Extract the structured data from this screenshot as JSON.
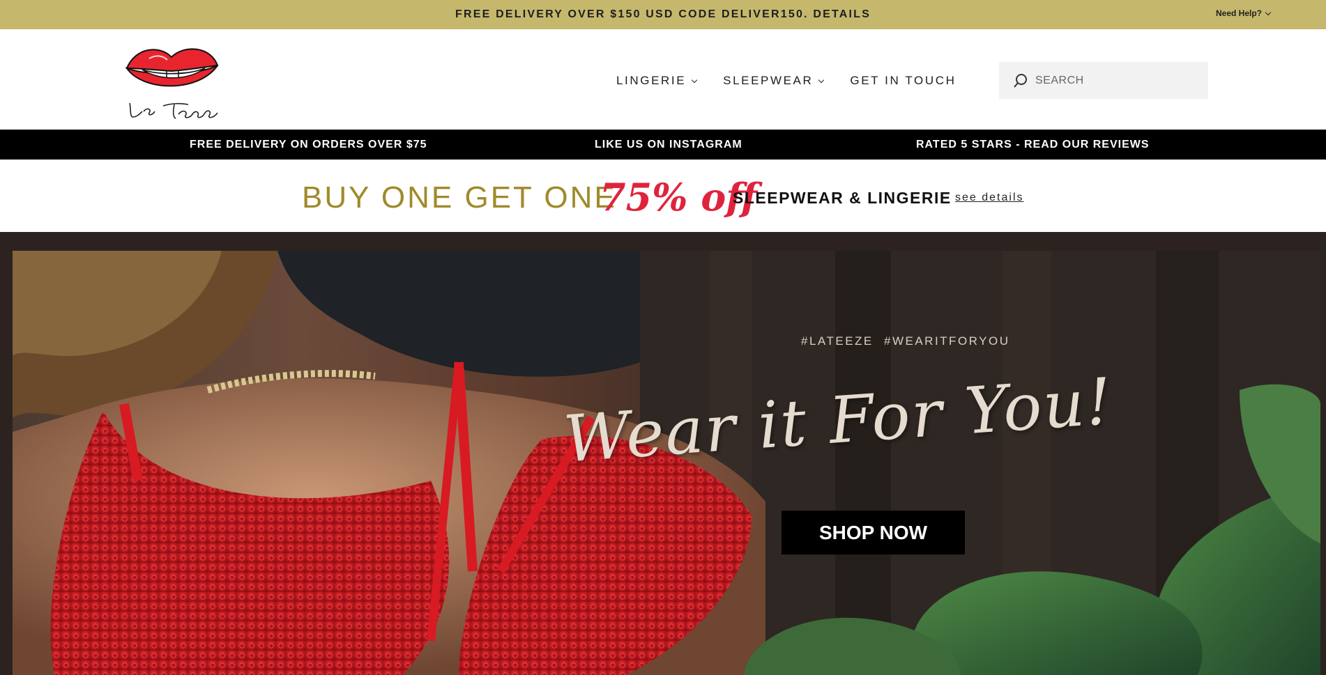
{
  "announcement": {
    "text": "FREE DELIVERY OVER $150 USD CODE DELIVER150. DETAILS",
    "need_help": "Need Help?"
  },
  "header": {
    "logo_text": "La Teeze",
    "nav": [
      {
        "label": "LINGERIE",
        "has_dropdown": true
      },
      {
        "label": "SLEEPWEAR",
        "has_dropdown": true
      },
      {
        "label": "GET IN TOUCH",
        "has_dropdown": false
      }
    ],
    "search": {
      "placeholder": "SEARCH",
      "value": ""
    }
  },
  "strip": {
    "items": [
      "FREE DELIVERY ON ORDERS OVER $75",
      "LIKE US ON INSTAGRAM",
      "RATED 5 STARS - READ OUR REVIEWS"
    ]
  },
  "promo": {
    "main": "BUY ONE GET ONE",
    "discount": "75% off",
    "category": "SLEEPWEAR & LINGERIE",
    "link": "see details"
  },
  "hero": {
    "hashtags": "#LATEEZE  #WEARITFORYOU",
    "tagline": "Wear it For You!",
    "cta": "SHOP NOW"
  },
  "colors": {
    "announcement_bg": "#c5b86d",
    "promo_gold": "#a08a2a",
    "promo_red": "#e0233d",
    "strip_bg": "#000000"
  }
}
